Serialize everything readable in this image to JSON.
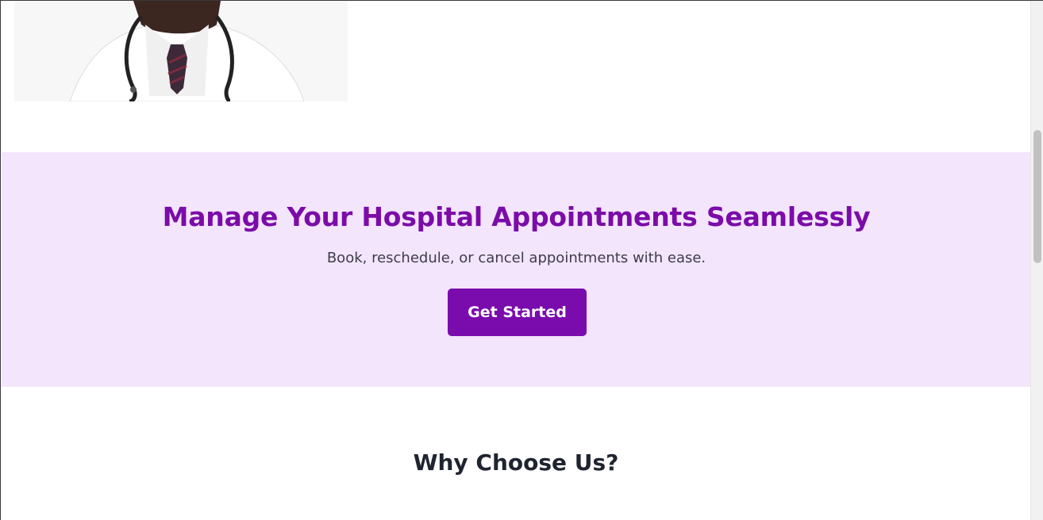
{
  "doctor_image": {
    "alt": "doctor-image"
  },
  "hero": {
    "title": "Manage Your Hospital Appointments Seamlessly",
    "subtitle": "Book, reschedule, or cancel appointments with ease.",
    "cta_label": "Get Started"
  },
  "why_section": {
    "title": "Why Choose Us?"
  },
  "colors": {
    "accent": "#7a0cad",
    "hero_bg": "#f3e5fc",
    "heading": "#1f2430"
  },
  "icons": [
    "stethoscope-icon"
  ]
}
